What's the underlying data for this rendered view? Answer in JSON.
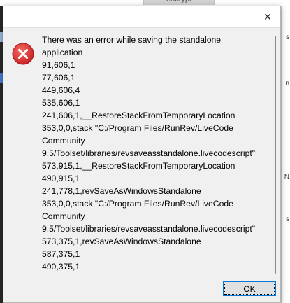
{
  "background": {
    "tab_fragment": "encrypt",
    "right_edge_letters": [
      "s",
      "n",
      "N",
      "s"
    ]
  },
  "dialog": {
    "close_glyph": "✕",
    "icon": "error-icon",
    "message_lines": [
      "There was an error while saving the standalone",
      "application",
      "91,606,1",
      "77,606,1",
      "449,606,4",
      "535,606,1",
      "241,606,1,__RestoreStackFromTemporaryLocation",
      "353,0,0,stack \"C:/Program Files/RunRev/LiveCode",
      "Community",
      "9.5/Toolset/libraries/revsaveasstandalone.livecodescript\"",
      "573,915,1,__RestoreStackFromTemporaryLocation",
      "490,915,1",
      "241,778,1,revSaveAsWindowsStandalone",
      "353,0,0,stack \"C:/Program Files/RunRev/LiveCode",
      "Community",
      "9.5/Toolset/libraries/revsaveasstandalone.livecodescript\"",
      "573,375,1,revSaveAsWindowsStandalone",
      "587,375,1",
      "490,375,1"
    ],
    "ok_label": "OK"
  },
  "colors": {
    "error_red": "#d9262a",
    "focus_blue": "#0078d7"
  }
}
